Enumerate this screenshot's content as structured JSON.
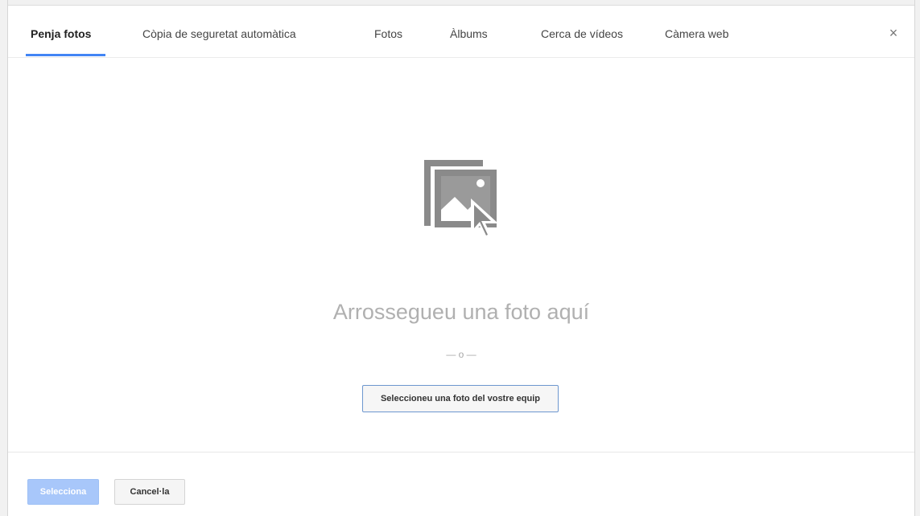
{
  "tabs": [
    {
      "label": "Penja fotos",
      "active": true
    },
    {
      "label": "Còpia de seguretat automàtica",
      "active": false
    },
    {
      "label": "Fotos",
      "active": false
    },
    {
      "label": "Àlbums",
      "active": false
    },
    {
      "label": "Cerca de vídeos",
      "active": false
    },
    {
      "label": "Càmera web",
      "active": false
    }
  ],
  "close_glyph": "×",
  "dropzone": {
    "icon": "image-drop-icon",
    "title": "Arrossegueu una foto aquí",
    "separator": "— o —",
    "pick_button": "Seleccioneu una foto del vostre equip"
  },
  "footer": {
    "select_label": "Selecciona",
    "cancel_label": "Cancel·la"
  },
  "colors": {
    "accent": "#4285f4",
    "select_disabled": "#a8c7fa",
    "icon_gray": "#8a8a8a"
  }
}
